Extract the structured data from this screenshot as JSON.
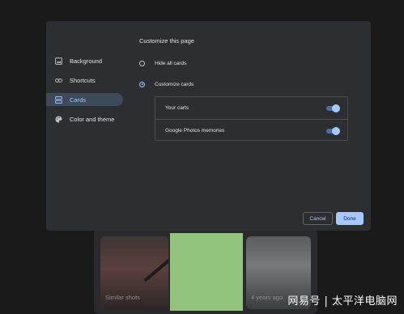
{
  "dialog": {
    "title": "Customize this page",
    "nav": [
      {
        "label": "Background",
        "icon": "image-icon"
      },
      {
        "label": "Shortcuts",
        "icon": "link-icon"
      },
      {
        "label": "Cards",
        "icon": "cards-icon",
        "active": true
      },
      {
        "label": "Color and theme",
        "icon": "palette-icon"
      }
    ],
    "options": {
      "hide_all": "Hide all cards",
      "customize": "Customize cards",
      "selected": "Customize cards"
    },
    "cards": [
      {
        "label": "Your carts",
        "enabled": true
      },
      {
        "label": "Google Photos memories",
        "enabled": true
      }
    ],
    "buttons": {
      "cancel": "Cancel",
      "done": "Done"
    }
  },
  "background": {
    "left_card_label": "Similar shots",
    "right_card_label": "4 years ago"
  },
  "watermark": "网易号 | 太平洋电脑网",
  "colors": {
    "dialog_bg": "#2d2e31",
    "accent": "#a8c7fa",
    "active_nav_bg": "#3c4a5c",
    "page_bg": "#1a1a1b"
  }
}
